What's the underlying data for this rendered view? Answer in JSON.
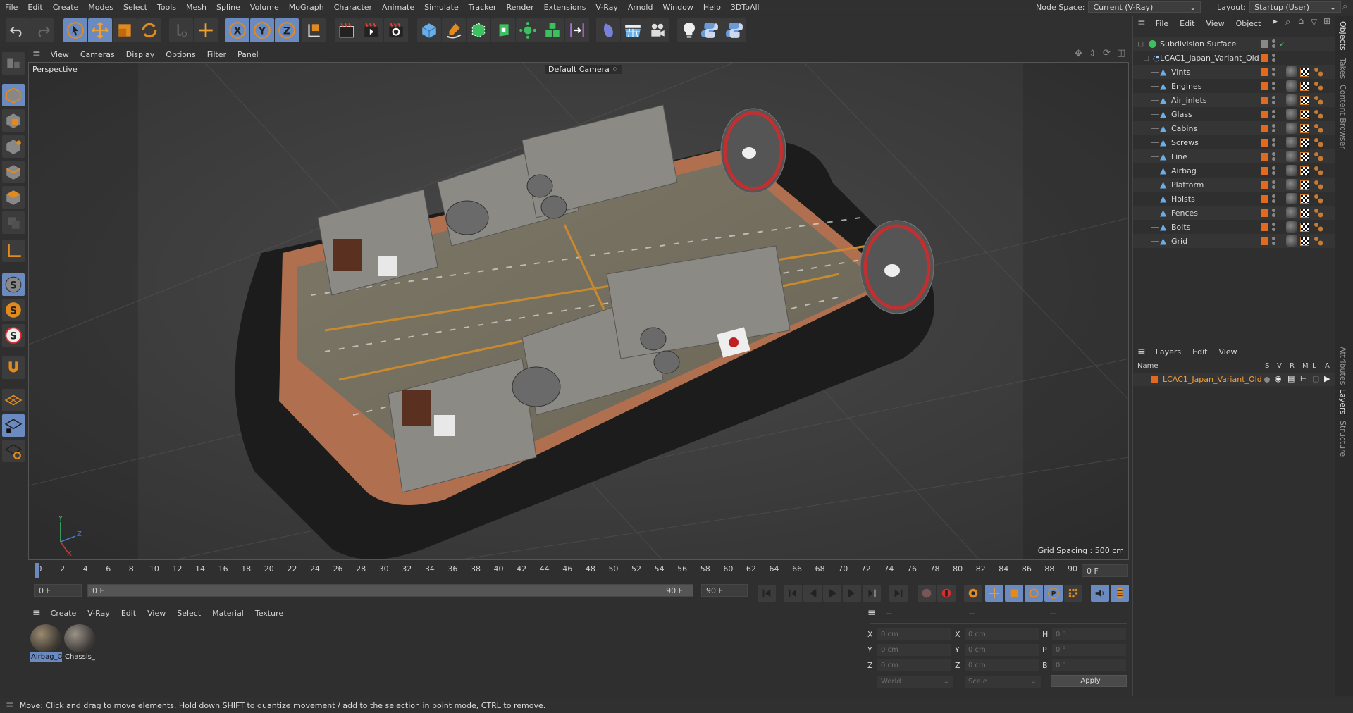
{
  "menubar": {
    "items": [
      "File",
      "Edit",
      "Create",
      "Modes",
      "Select",
      "Tools",
      "Mesh",
      "Spline",
      "Volume",
      "MoGraph",
      "Character",
      "Animate",
      "Simulate",
      "Tracker",
      "Render",
      "Extensions",
      "V-Ray",
      "Arnold",
      "Window",
      "Help",
      "3DToAll"
    ],
    "node_space_label": "Node Space:",
    "node_space_value": "Current (V-Ray)",
    "layout_label": "Layout:",
    "layout_value": "Startup (User)"
  },
  "toolbar": {
    "icons": [
      "undo-icon",
      "redo-icon",
      "select-icon",
      "move-icon",
      "scale-icon",
      "rotate-icon",
      "recent-tool-icon",
      "add-icon",
      "x-axis-icon",
      "y-axis-icon",
      "z-axis-icon",
      "coordinate-system-icon",
      "render-view-icon",
      "render-picture-viewer-icon",
      "render-settings-icon",
      "cube-icon",
      "pen-icon",
      "subdivision-icon",
      "extrude-icon",
      "cloner-icon",
      "mograph-icon",
      "deformer-icon",
      "field-icon",
      "floor-icon",
      "camera-icon",
      "light-icon",
      "python-icon",
      "python-icon-2"
    ]
  },
  "viewport": {
    "menu": [
      "View",
      "Cameras",
      "Display",
      "Options",
      "Filter",
      "Panel"
    ],
    "label": "Perspective",
    "camera": "Default Camera",
    "grid_spacing": "Grid Spacing : 500 cm",
    "axes": {
      "x": "X",
      "y": "Y",
      "z": "Z"
    }
  },
  "left_tools": [
    "model-icon",
    "texture-icon",
    "points-icon",
    "edges-icon",
    "polygons-icon",
    "uv-icon",
    "axis-icon",
    "snap-icon",
    "snap-settings-icon",
    "soft-selection-icon",
    "magnet-icon",
    "workplane-icon",
    "lock-workplane-icon",
    "planar-workplane-icon"
  ],
  "timeline": {
    "ticks": [
      "0",
      "2",
      "4",
      "6",
      "8",
      "10",
      "12",
      "14",
      "16",
      "18",
      "20",
      "22",
      "24",
      "26",
      "28",
      "30",
      "32",
      "34",
      "36",
      "38",
      "40",
      "42",
      "44",
      "46",
      "48",
      "50",
      "52",
      "54",
      "56",
      "58",
      "60",
      "62",
      "64",
      "66",
      "68",
      "70",
      "72",
      "74",
      "76",
      "78",
      "80",
      "82",
      "84",
      "86",
      "88",
      "90"
    ],
    "current_frame_right": "0 F",
    "start_field": "0 F",
    "range_start": "0 F",
    "range_end": "90 F",
    "end_field": "90 F",
    "current_position": 0
  },
  "material_panel": {
    "menu": [
      "Create",
      "V-Ray",
      "Edit",
      "View",
      "Select",
      "Material",
      "Texture"
    ],
    "materials": [
      {
        "name": "Airbag_O",
        "selected": true
      },
      {
        "name": "Chassis_",
        "selected": false
      }
    ]
  },
  "coord_panel": {
    "headers": [
      "--",
      "--",
      "--"
    ],
    "rows": [
      {
        "l1": "X",
        "v1": "0 cm",
        "l2": "X",
        "v2": "0 cm",
        "l3": "H",
        "v3": "0 °"
      },
      {
        "l1": "Y",
        "v1": "0 cm",
        "l2": "Y",
        "v2": "0 cm",
        "l3": "P",
        "v3": "0 °"
      },
      {
        "l1": "Z",
        "v1": "0 cm",
        "l2": "Z",
        "v2": "0 cm",
        "l3": "B",
        "v3": "0 °"
      }
    ],
    "world": "World",
    "scale": "Scale",
    "apply": "Apply"
  },
  "object_manager": {
    "menu": [
      "File",
      "Edit",
      "View",
      "Object"
    ],
    "root": "Subdivision Surface",
    "group": "LCAC1_Japan_Variant_Old",
    "children": [
      "Vints",
      "Engines",
      "Air_inlets",
      "Glass",
      "Cabins",
      "Screws",
      "Line",
      "Airbag",
      "Platform",
      "Hoists",
      "Fences",
      "Bolts",
      "Grid"
    ]
  },
  "layer_manager": {
    "menu": [
      "Layers",
      "Edit",
      "View"
    ],
    "columns": {
      "name": "Name",
      "s": "S",
      "v": "V",
      "r": "R",
      "m": "M",
      "l": "L",
      "a": "A"
    },
    "layers": [
      {
        "name": "LCAC1_Japan_Variant_Old",
        "color": "#e06a1f"
      }
    ]
  },
  "side_tabs": [
    "Objects",
    "Takes",
    "Content Browser",
    "Attributes",
    "Layers",
    "Structure"
  ],
  "status": "Move: Click and drag to move elements. Hold down SHIFT to quantize movement / add to the selection in point mode, CTRL to remove.",
  "colors": {
    "accent": "#6b8bc0",
    "orange": "#e06a1f",
    "bg": "#2f2f2f"
  }
}
